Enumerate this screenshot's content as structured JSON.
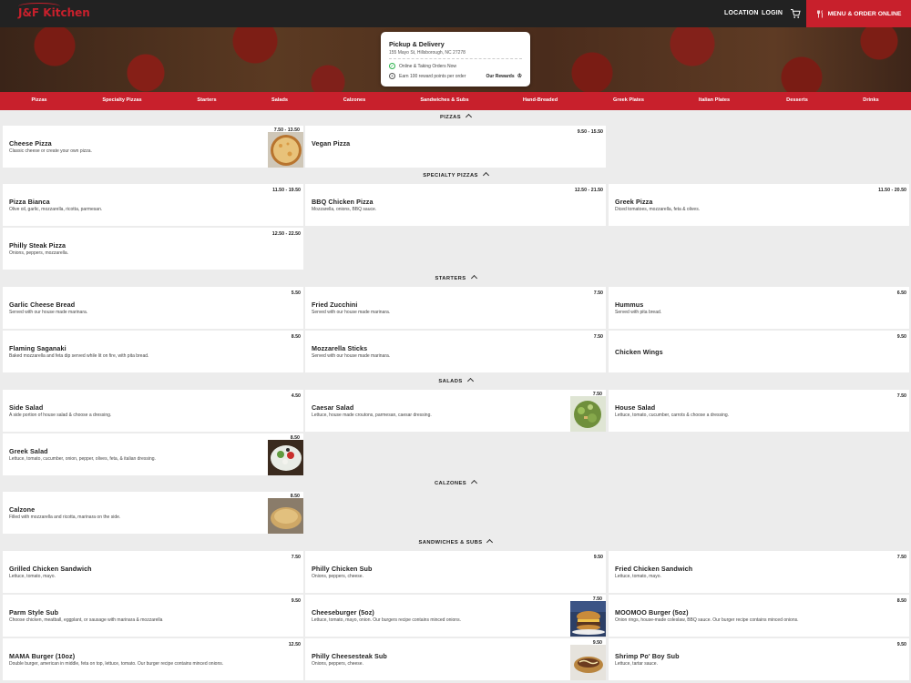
{
  "header": {
    "logo": "J&F Kitchen",
    "nav": [
      "LOCATION",
      "LOGIN"
    ],
    "order_button": "MENU & ORDER ONLINE",
    "brand_color": "#c8202c"
  },
  "info_card": {
    "title": "Pickup & Delivery",
    "address": "155 Mayo St, Hillsborough, NC 27278",
    "status": "Online & Taking Orders Now",
    "rewards_note": "Earn 100 reward points per order",
    "rewards_link": "Our Rewards"
  },
  "categories": [
    "Pizzas",
    "Specialty Pizzas",
    "Starters",
    "Salads",
    "Calzones",
    "Sandwiches & Subs",
    "Hand-Breaded",
    "Greek Plates",
    "Italian Plates",
    "Desserts",
    "Drinks"
  ],
  "sections": [
    {
      "title": "PIZZAS",
      "items": [
        {
          "name": "Cheese Pizza",
          "desc": "Classic cheese or create your own pizza.",
          "price": "7.50 - 13.50",
          "thumb": "pizza"
        },
        {
          "name": "Vegan Pizza",
          "desc": "",
          "price": "9.50 - 15.50"
        }
      ]
    },
    {
      "title": "SPECIALTY PIZZAS",
      "items": [
        {
          "name": "Pizza Bianca",
          "desc": "Olive oil, garlic, mozzarella, ricotta, parmesan.",
          "price": "11.50 - 19.50"
        },
        {
          "name": "BBQ Chicken Pizza",
          "desc": "Mozzarella, onions, BBQ sauce.",
          "price": "12.50 - 21.50"
        },
        {
          "name": "Greek Pizza",
          "desc": "Diced tomatoes, mozzarella, feta & olives.",
          "price": "11.50 - 20.50"
        },
        {
          "name": "Philly Steak Pizza",
          "desc": "Onions, peppers, mozzarella.",
          "price": "12.50 - 22.50"
        }
      ]
    },
    {
      "title": "STARTERS",
      "items": [
        {
          "name": "Garlic Cheese Bread",
          "desc": "Served with our house made marinara.",
          "price": "5.50"
        },
        {
          "name": "Fried Zucchini",
          "desc": "Served with our house made marinara.",
          "price": "7.50"
        },
        {
          "name": "Hummus",
          "desc": "Served with pita bread.",
          "price": "6.50"
        },
        {
          "name": "Flaming Saganaki",
          "desc": "Baked mozzarella and feta dip served while lit on fire, with pita bread.",
          "price": "8.50"
        },
        {
          "name": "Mozzarella Sticks",
          "desc": "Served with our house made marinara.",
          "price": "7.50"
        },
        {
          "name": "Chicken Wings",
          "desc": "",
          "price": "9.50"
        }
      ]
    },
    {
      "title": "SALADS",
      "items": [
        {
          "name": "Side Salad",
          "desc": "A side portion of house salad & choose a dressing.",
          "price": "4.50"
        },
        {
          "name": "Caesar Salad",
          "desc": "Lettuce, house made croutons, parmesan, caesar dressing.",
          "price": "7.50",
          "thumb": "caesar"
        },
        {
          "name": "House Salad",
          "desc": "Lettuce, tomato, cucumber, carrots & choose a dressing.",
          "price": "7.50"
        },
        {
          "name": "Greek Salad",
          "desc": "Lettuce, tomato, cucumber, onion, pepper, olives, feta, & italian dressing.",
          "price": "8.50",
          "thumb": "greek"
        }
      ]
    },
    {
      "title": "CALZONES",
      "items": [
        {
          "name": "Calzone",
          "desc": "Filled with mozzarella and ricotta, marinara on the side.",
          "price": "8.50",
          "thumb": "calzone"
        }
      ]
    },
    {
      "title": "SANDWICHES & SUBS",
      "items": [
        {
          "name": "Grilled Chicken Sandwich",
          "desc": "Lettuce, tomato, mayo.",
          "price": "7.50"
        },
        {
          "name": "Philly Chicken Sub",
          "desc": "Onions, peppers, cheese.",
          "price": "9.50"
        },
        {
          "name": "Fried Chicken Sandwich",
          "desc": "Lettuce, tomato, mayo.",
          "price": "7.50"
        },
        {
          "name": "Parm Style Sub",
          "desc": "Choose chicken, meatball, eggplant, or sausage with marinara & mozzarella",
          "price": "9.50"
        },
        {
          "name": "Cheeseburger (5oz)",
          "desc": "Lettuce, tomato, mayo, onion. Our burgers recipe contains minced onions.",
          "price": "7.50",
          "thumb": "burger"
        },
        {
          "name": "MOOMOO Burger (5oz)",
          "desc": "Onion rings, house-made coleslaw, BBQ sauce. Our burger recipe contains minced onions.",
          "price": "8.50"
        },
        {
          "name": "MAMA Burger (10oz)",
          "desc": "Double burger, american in middle, feta on top, lettuce, tomato. Our burger recipe contains minced onions.",
          "price": "12.50"
        },
        {
          "name": "Philly Cheesesteak Sub",
          "desc": "Onions, peppers, cheese.",
          "price": "9.50",
          "thumb": "philly"
        },
        {
          "name": "Shrimp Po' Boy Sub",
          "desc": "Lettuce, tartar sauce.",
          "price": "9.50"
        }
      ]
    }
  ]
}
